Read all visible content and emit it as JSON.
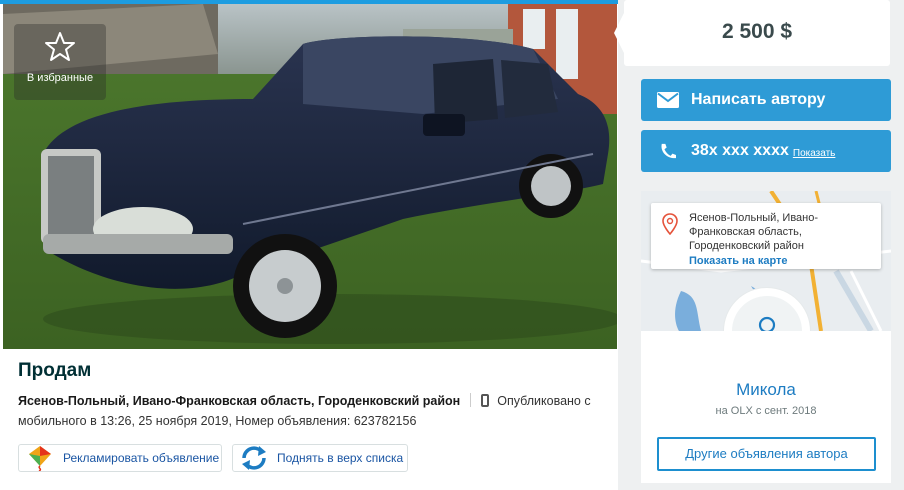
{
  "favorites": {
    "label": "В избранные",
    "icon": "star-outline-icon"
  },
  "ad": {
    "title": "Продам",
    "location": "Ясенов-Польный, Ивано-Франковская область, Городенковский район",
    "published_prefix": "Опубликовано с мобильного",
    "published_at": "в 13:26, 25 ноября 2019,",
    "ad_number": "Номер объявления: 623782156"
  },
  "actions": {
    "promote_label": "Рекламировать объявление",
    "raise_label": "Поднять в верх списка"
  },
  "price": "2 500 $",
  "contact": {
    "write_label": "Написать автору",
    "phone_masked": "38x xxx xxxx",
    "show_label": "Показать"
  },
  "map": {
    "location_text": "Ясенов-Польный, Ивано-Франковская область, Городенковский район",
    "show_on_map": "Показать на карте"
  },
  "seller": {
    "name": "Микола",
    "since": "на OLX с сент. 2018",
    "other_ads_label": "Другие объявления автора"
  },
  "colors": {
    "accent": "#2e9bd6",
    "link": "#1d7cc2",
    "top_strip": "#1d9ce0"
  }
}
